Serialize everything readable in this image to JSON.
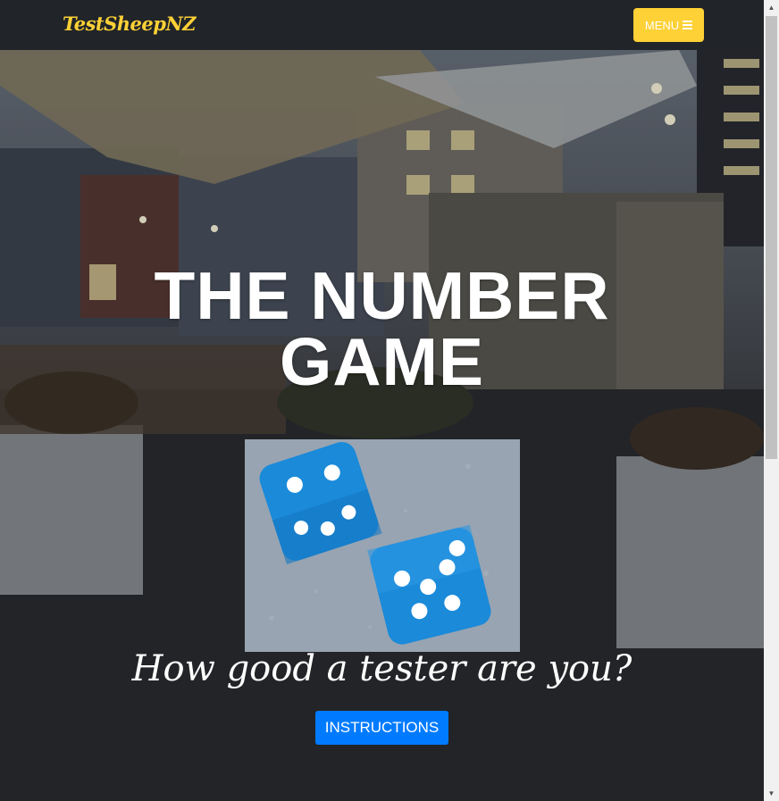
{
  "navbar": {
    "brand": "TestSheepNZ",
    "menu_label": "MENU",
    "menu_icon": "hamburger-icon",
    "accent_color": "#fed136",
    "background_color": "#212529"
  },
  "hero": {
    "title_line1": "THE NUMBER",
    "title_line2": "GAME",
    "image_subject": "two blue dice",
    "subtitle": "How good a tester are you?",
    "instructions_label": "INSTRUCTIONS",
    "button_color": "#007bff"
  },
  "scrollbar": {
    "up_icon": "arrow-up-icon",
    "down_icon": "arrow-down-icon"
  }
}
